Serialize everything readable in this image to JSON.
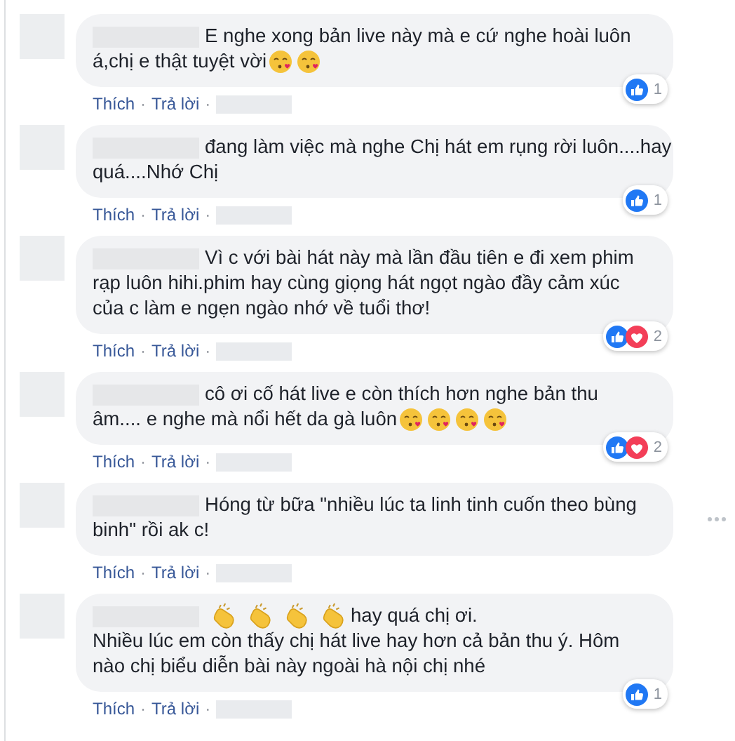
{
  "comments": [
    {
      "lines": [
        [
          {
            "kind": "text",
            "text": "E nghe xong bản live này mà e cứ nghe hoài luôn"
          }
        ],
        [
          {
            "kind": "text",
            "text": "á,chị e thật tuyệt vời"
          },
          {
            "kind": "kiss_emoji"
          },
          {
            "kind": "kiss_emoji"
          }
        ]
      ],
      "actions": [
        {
          "kind": "link",
          "text": "Thích"
        },
        {
          "kind": "separator",
          "text": "·"
        },
        {
          "kind": "link",
          "text": "Trả lời"
        },
        {
          "kind": "separator",
          "text": "·"
        }
      ],
      "reactions": [
        {
          "kind": "like"
        }
      ],
      "reaction_count": "1",
      "menu": false
    },
    {
      "lines": [
        [
          {
            "kind": "text",
            "text": "đang làm việc mà nghe Chị hát em rụng rời luôn....hay"
          }
        ],
        [
          {
            "kind": "text",
            "text": "quá....Nhớ Chị"
          }
        ]
      ],
      "actions": [
        {
          "kind": "link",
          "text": "Thích"
        },
        {
          "kind": "separator",
          "text": "·"
        },
        {
          "kind": "link",
          "text": "Trả lời"
        },
        {
          "kind": "separator",
          "text": "·"
        }
      ],
      "reactions": [
        {
          "kind": "like"
        }
      ],
      "reaction_count": "1",
      "menu": false
    },
    {
      "lines": [
        [
          {
            "kind": "text",
            "text": "Vì c với bài hát này mà lần đầu tiên e đi xem phim"
          }
        ],
        [
          {
            "kind": "text",
            "text": "rạp luôn hihi.phim hay cùng giọng hát ngọt ngào đầy cảm xúc"
          }
        ],
        [
          {
            "kind": "text",
            "text": "của c làm e ngẹn ngào nhớ về tuổi thơ!"
          }
        ]
      ],
      "actions": [
        {
          "kind": "link",
          "text": "Thích"
        },
        {
          "kind": "separator",
          "text": "·"
        },
        {
          "kind": "link",
          "text": "Trả lời"
        },
        {
          "kind": "separator",
          "text": "·"
        }
      ],
      "reactions": [
        {
          "kind": "like"
        },
        {
          "kind": "love"
        }
      ],
      "reaction_count": "2",
      "menu": false
    },
    {
      "lines": [
        [
          {
            "kind": "text",
            "text": "cô ơi cố hát live e còn thích hơn nghe bản thu"
          }
        ],
        [
          {
            "kind": "text",
            "text": "âm.... e nghe mà nổi hết da gà luôn"
          },
          {
            "kind": "kiss_emoji"
          },
          {
            "kind": "kiss_emoji"
          },
          {
            "kind": "kiss_emoji"
          },
          {
            "kind": "kiss_emoji"
          }
        ]
      ],
      "actions": [
        {
          "kind": "link",
          "text": "Thích"
        },
        {
          "kind": "separator",
          "text": "·"
        },
        {
          "kind": "link",
          "text": "Trả lời"
        },
        {
          "kind": "separator",
          "text": "·"
        }
      ],
      "reactions": [
        {
          "kind": "like"
        },
        {
          "kind": "love"
        }
      ],
      "reaction_count": "2",
      "menu": false
    },
    {
      "lines": [
        [
          {
            "kind": "text",
            "text": "Hóng từ bữa \"nhiều lúc ta linh tinh cuốn theo bùng"
          }
        ],
        [
          {
            "kind": "text",
            "text": "binh\" rồi ak c!"
          }
        ]
      ],
      "actions": [
        {
          "kind": "link",
          "text": "Thích"
        },
        {
          "kind": "separator",
          "text": "·"
        },
        {
          "kind": "link",
          "text": "Trả lời"
        },
        {
          "kind": "separator",
          "text": "·"
        }
      ],
      "menu": true
    },
    {
      "lines": [
        [
          {
            "kind": "clap_emoji"
          },
          {
            "kind": "clap_emoji"
          },
          {
            "kind": "clap_emoji"
          },
          {
            "kind": "clap_emoji"
          },
          {
            "kind": "text",
            "text": "hay quá chị ơi."
          }
        ],
        [
          {
            "kind": "text",
            "text": "Nhiều lúc em còn thấy chị hát live hay hơn cả bản thu ý. Hôm"
          }
        ],
        [
          {
            "kind": "text",
            "text": "nào chị biểu diễn bài này ngoài hà nội chị nhé"
          }
        ]
      ],
      "actions": [
        {
          "kind": "link",
          "text": "Thích"
        },
        {
          "kind": "separator",
          "text": "·"
        },
        {
          "kind": "link",
          "text": "Trả lời"
        },
        {
          "kind": "separator",
          "text": "·"
        }
      ],
      "reactions": [
        {
          "kind": "like"
        }
      ],
      "reaction_count": "1",
      "menu": false
    }
  ]
}
